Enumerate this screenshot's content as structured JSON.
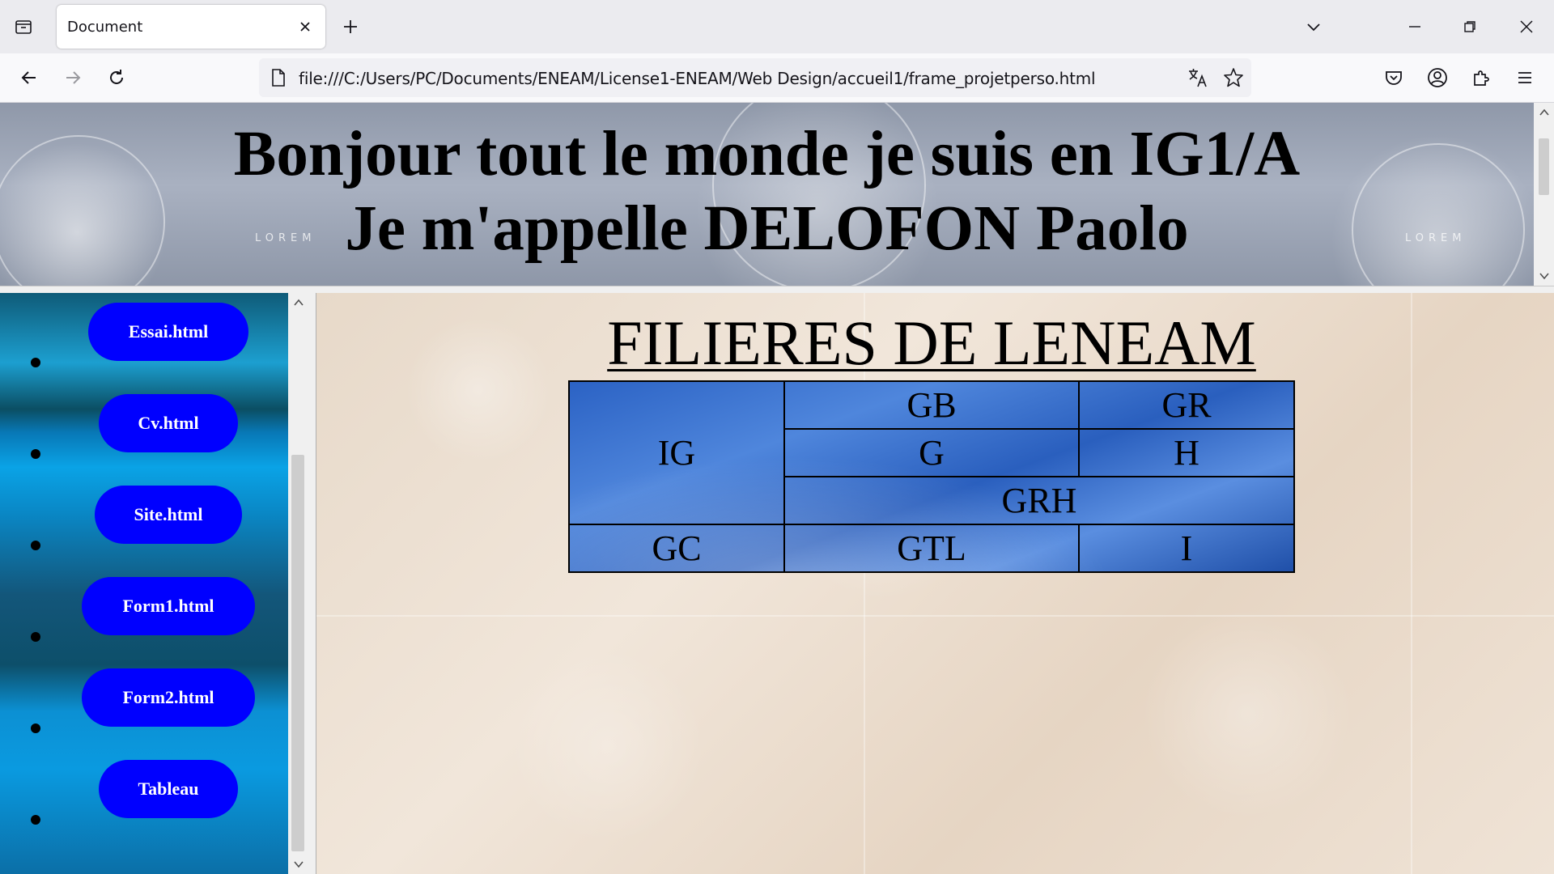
{
  "browser": {
    "tab_title": "Document",
    "url": "file:///C:/Users/PC/Documents/ENEAM/License1-ENEAM/Web Design/accueil1/frame_projetperso.html"
  },
  "icons": {
    "tab_list": "tab-list-icon",
    "close_tab": "close-icon",
    "new_tab": "plus-icon",
    "back": "arrow-left-icon",
    "forward": "arrow-right-icon",
    "reload": "reload-icon",
    "page": "page-icon",
    "translate": "translate-icon",
    "bookmark": "star-icon",
    "pocket": "pocket-icon",
    "account": "account-icon",
    "extensions": "puzzle-icon",
    "menu": "hamburger-menu-icon"
  },
  "header": {
    "line1": "Bonjour tout le monde je suis en IG1/A",
    "line2": "Je m'appelle DELOFON Paolo",
    "background_text": "LOREM"
  },
  "sidebar": {
    "items": [
      {
        "label": "Essai.html"
      },
      {
        "label": "Cv.html"
      },
      {
        "label": "Site.html"
      },
      {
        "label": "Form1.html"
      },
      {
        "label": "Form2.html"
      },
      {
        "label": "Tableau"
      }
    ]
  },
  "main": {
    "title": "FILIERES DE LENEAM",
    "table": {
      "IG": "IG",
      "GB": "GB",
      "GR": "GR",
      "G": "G",
      "H": "H",
      "GRH": "GRH",
      "GC": "GC",
      "GTL": "GTL",
      "I": "I"
    }
  },
  "colors": {
    "pill": "#0000ff",
    "pill_text": "#ffffff",
    "table_blue": "#2b62c4"
  }
}
